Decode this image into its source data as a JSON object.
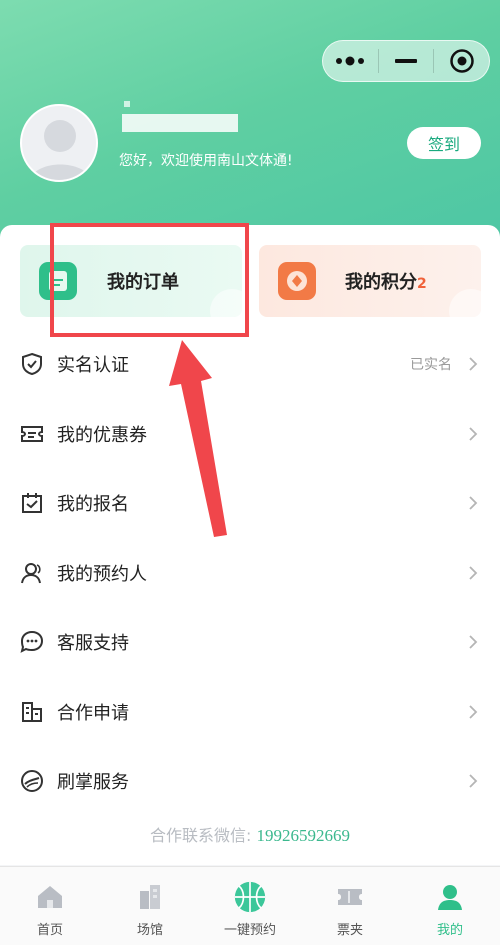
{
  "header": {
    "welcome": "您好，欢迎使用南山文体通!",
    "checkin_label": "签到",
    "accent": "#5fcfa2"
  },
  "capsule": {
    "more_icon": "more-dots-icon",
    "minimize_icon": "minimize-icon",
    "close_icon": "target-close-icon"
  },
  "cards": {
    "orders_label": "我的订单",
    "points_label": "我的积分",
    "points_count": "2"
  },
  "menu": [
    {
      "label": "实名认证",
      "value": "已实名",
      "icon": "shield-check-icon"
    },
    {
      "label": "我的优惠券",
      "value": "",
      "icon": "ticket-icon"
    },
    {
      "label": "我的报名",
      "value": "",
      "icon": "calendar-check-icon"
    },
    {
      "label": "我的预约人",
      "value": "",
      "icon": "people-icon"
    },
    {
      "label": "客服支持",
      "value": "",
      "icon": "chat-bubble-icon"
    },
    {
      "label": "合作申请",
      "value": "",
      "icon": "building-icon"
    },
    {
      "label": "刷掌服务",
      "value": "",
      "icon": "palm-scan-icon"
    }
  ],
  "contact": {
    "label": "合作联系微信:",
    "phone": "19926592669"
  },
  "tabs": [
    {
      "label": "首页",
      "icon": "home-icon",
      "active": false
    },
    {
      "label": "场馆",
      "icon": "venue-building-icon",
      "active": false
    },
    {
      "label": "一键预约",
      "icon": "basketball-icon",
      "active": false
    },
    {
      "label": "票夹",
      "icon": "ticket-folder-icon",
      "active": false
    },
    {
      "label": "我的",
      "icon": "profile-icon",
      "active": true
    }
  ],
  "colors": {
    "primary_green": "#2fbf8a",
    "orange": "#f27a46",
    "annotation_red": "#f0464b"
  }
}
